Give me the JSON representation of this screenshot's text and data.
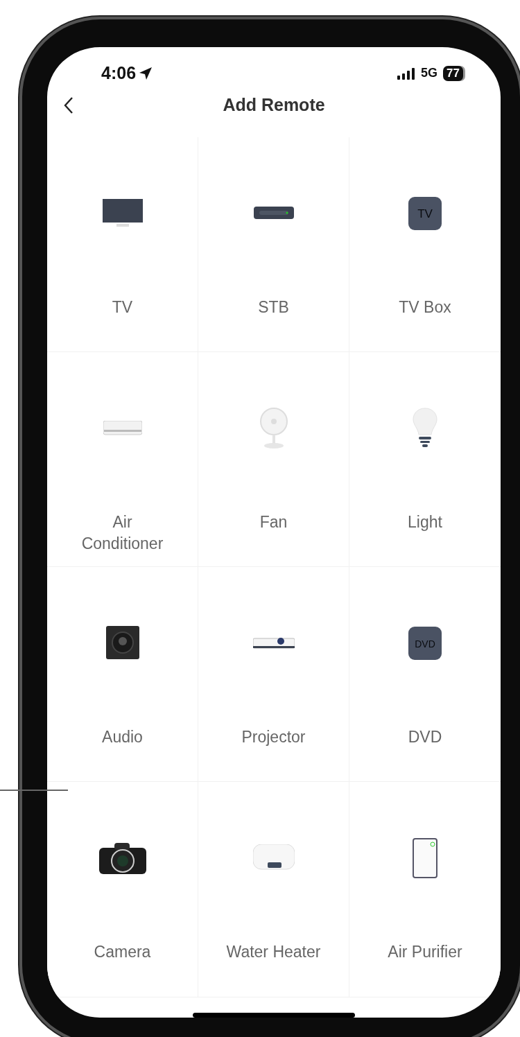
{
  "status_bar": {
    "time": "4:06",
    "network": "5G",
    "battery": "77"
  },
  "nav": {
    "title": "Add Remote"
  },
  "devices": [
    {
      "kind": "tv",
      "label": "TV"
    },
    {
      "kind": "stb",
      "label": "STB"
    },
    {
      "kind": "tvbox",
      "label": "TV Box",
      "icon_text": "TV"
    },
    {
      "kind": "ac",
      "label": "Air Conditioner"
    },
    {
      "kind": "fan",
      "label": "Fan"
    },
    {
      "kind": "light",
      "label": "Light"
    },
    {
      "kind": "audio",
      "label": "Audio"
    },
    {
      "kind": "projector",
      "label": "Projector"
    },
    {
      "kind": "dvd",
      "label": "DVD",
      "icon_text": "DVD"
    },
    {
      "kind": "camera",
      "label": "Camera"
    },
    {
      "kind": "heater",
      "label": "Water Heater"
    },
    {
      "kind": "purifier",
      "label": "Air Purifier"
    }
  ]
}
